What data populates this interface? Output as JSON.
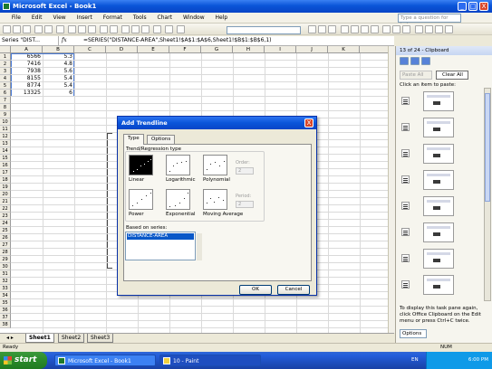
{
  "window": {
    "title": "Microsoft Excel - Book1",
    "min": "_",
    "max": "□",
    "close": "X"
  },
  "menu": [
    "File",
    "Edit",
    "View",
    "Insert",
    "Format",
    "Tools",
    "Chart",
    "Window",
    "Help"
  ],
  "ask": {
    "placeholder": "Type a question for help"
  },
  "formula_bar": {
    "name_box": "Series \"DIST...",
    "fx": "fx",
    "formula": "=SERIES(\"DISTANCE-AREA\",Sheet1!$A$1:$A$6,Sheet1!$B$1:$B$6,1)"
  },
  "columns": [
    "A",
    "B",
    "C",
    "D",
    "E",
    "F",
    "G",
    "H",
    "I",
    "J",
    "K"
  ],
  "rows": [
    "1",
    "2",
    "3",
    "4",
    "5",
    "6",
    "7",
    "8",
    "9",
    "10",
    "11",
    "12",
    "13",
    "14",
    "15",
    "16",
    "17",
    "18",
    "19",
    "20",
    "21",
    "22",
    "23",
    "24",
    "25",
    "26",
    "27",
    "28",
    "29",
    "30",
    "31",
    "32",
    "33",
    "34",
    "35",
    "36",
    "37",
    "38"
  ],
  "cells": [
    {
      "a": "6566",
      "b": "5.3"
    },
    {
      "a": "7416",
      "b": "4.8"
    },
    {
      "a": "7938",
      "b": "5.6"
    },
    {
      "a": "8155",
      "b": "5.4"
    },
    {
      "a": "8774",
      "b": "5.4"
    },
    {
      "a": "13325",
      "b": "6"
    }
  ],
  "sheets": [
    "Sheet1",
    "Sheet2",
    "Sheet3"
  ],
  "status": "Ready",
  "status_right": "NUM",
  "taskpane": {
    "title": "13 of 24 - Clipboard",
    "paste_all": "Paste All",
    "clear_all": "Clear All",
    "instruction": "Click an item to paste:",
    "footer": "To display this task pane again, click Office Clipboard on the Edit menu or press Ctrl+C twice.",
    "options": "Options"
  },
  "dialog": {
    "title": "Add Trendline",
    "close": "X",
    "tabs": [
      "Type",
      "Options"
    ],
    "group_label": "Trend/Regression type",
    "types": [
      "Linear",
      "Logarithmic",
      "Polynomial",
      "Power",
      "Exponential",
      "Moving Average"
    ],
    "order_label": "Order:",
    "order_value": "2",
    "period_label": "Period:",
    "period_value": "2",
    "based_on_label": "Based on series:",
    "series": [
      "DISTANCE-AREA"
    ],
    "ok": "OK",
    "cancel": "Cancel"
  },
  "taskbar": {
    "start": "start",
    "tasks": [
      "Microsoft Excel - Book1",
      "10 - Paint"
    ],
    "lang": "EN",
    "clock": "6:00 PM"
  }
}
